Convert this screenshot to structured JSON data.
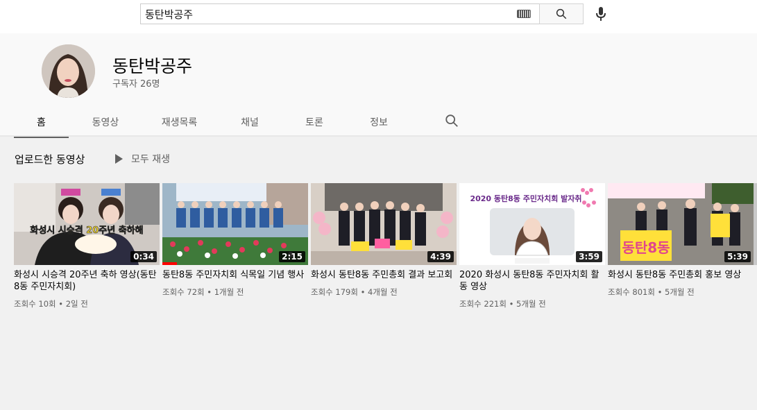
{
  "search": {
    "value": "동탄박공주"
  },
  "channel": {
    "name": "동탄박공주",
    "subscribers": "구독자 26명"
  },
  "tabs": [
    {
      "label": "홈",
      "active": true
    },
    {
      "label": "동영상"
    },
    {
      "label": "재생목록"
    },
    {
      "label": "채널"
    },
    {
      "label": "토론"
    },
    {
      "label": "정보"
    }
  ],
  "section": {
    "title": "업로드한 동영상",
    "play_all": "모두 재생"
  },
  "videos": [
    {
      "title": "화성시 시승격 20주년 축하 영상(동탄8동 주민자치회)",
      "meta": "조회수 10회 • 2일 전",
      "duration": "0:34",
      "thumb_caption": "화성시 시승격 20주년 축하해"
    },
    {
      "title": "동탄8동 주민자치회 식목일 기념 행사",
      "meta": "조회수 72회 • 1개월 전",
      "duration": "2:15",
      "watched_fraction": 0.1
    },
    {
      "title": "화성시 동탄8동 주민총회 결과 보고회",
      "meta": "조회수 179회 • 4개월 전",
      "duration": "4:39"
    },
    {
      "title": "2020 화성시 동탄8동 주민자치회 활동 영상",
      "meta": "조회수 221회 • 5개월 전",
      "duration": "3:59",
      "thumb_caption": "2020 동탄8동 주민자치회 발자취"
    },
    {
      "title": "화성시 동탄8동 주민총회 홍보 영상",
      "meta": "조회수 801회 • 5개월 전",
      "duration": "5:39",
      "thumb_caption": "동탄8동"
    }
  ]
}
